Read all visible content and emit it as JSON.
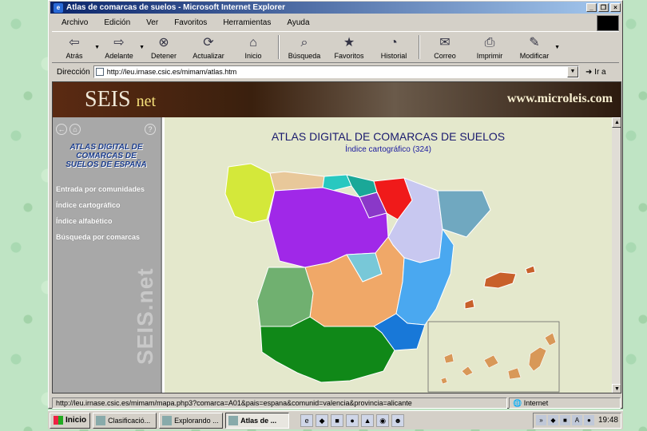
{
  "window": {
    "title": "Atlas de comarcas de suelos - Microsoft Internet Explorer"
  },
  "menu": [
    "Archivo",
    "Edición",
    "Ver",
    "Favoritos",
    "Herramientas",
    "Ayuda"
  ],
  "toolbar": [
    {
      "label": "Atrás",
      "icon": "back-arrow-icon",
      "glyph": "⇦"
    },
    {
      "label": "Adelante",
      "icon": "forward-arrow-icon",
      "glyph": "⇨"
    },
    {
      "label": "Detener",
      "icon": "stop-icon",
      "glyph": "⊗"
    },
    {
      "label": "Actualizar",
      "icon": "refresh-icon",
      "glyph": "⟳"
    },
    {
      "label": "Inicio",
      "icon": "home-icon",
      "glyph": "⌂"
    },
    {
      "label": "Búsqueda",
      "icon": "search-icon",
      "glyph": "⌕"
    },
    {
      "label": "Favoritos",
      "icon": "favorites-icon",
      "glyph": "★"
    },
    {
      "label": "Historial",
      "icon": "history-icon",
      "glyph": "◔"
    },
    {
      "label": "Correo",
      "icon": "mail-icon",
      "glyph": "✉"
    },
    {
      "label": "Imprimir",
      "icon": "print-icon",
      "glyph": "⎙"
    },
    {
      "label": "Modificar",
      "icon": "edit-icon",
      "glyph": "✎"
    }
  ],
  "address": {
    "label": "Dirección",
    "url": "http://leu.irnase.csic.es/mimam/atlas.htm",
    "go": "Ir a"
  },
  "banner": {
    "brand": "SEIS",
    "brand_suffix": "net",
    "site": "www.microleis.com"
  },
  "sidebar": {
    "title_lines": [
      "ATLAS DIGITAL DE",
      "COMARCAS DE",
      "SUELOS DE ESPAÑA"
    ],
    "links": [
      "Entrada por comunidades",
      "Índice cartográfico",
      "Índice alfabético",
      "Búsqueda por comarcas"
    ],
    "watermark": "SEIS.net"
  },
  "main": {
    "title": "ATLAS DIGITAL DE COMARCAS DE SUELOS",
    "subtitle": "Índice cartográfico (324)"
  },
  "status": {
    "url": "http://leu.irnase.csic.es/mimam/mapa.php3?comarca=A01&pais=espana&comunid=valencia&provincia=alicante",
    "zone": "Internet"
  },
  "taskbar": {
    "start": "Inicio",
    "tasks": [
      "Clasificació...",
      "Explorando ...",
      "Atlas de ..."
    ],
    "clock": "19:48"
  },
  "colors": {
    "galicia": "#d4e83a",
    "asturias": "#e8c89a",
    "cantabria": "#28c8c0",
    "pais_vasco": "#1aa898",
    "navarra": "#f01a1a",
    "castilla_leon": "#a028e8",
    "rioja": "#8a38c8",
    "aragon": "#c8c8f0",
    "cataluna": "#70a8c0",
    "madrid": "#78c8d8",
    "castilla_mancha": "#f0a868",
    "extremadura": "#70b070",
    "valencia": "#4aa8f0",
    "murcia": "#1878d8",
    "andalucia": "#108818",
    "baleares": "#c8602a",
    "canarias": "#d89858"
  }
}
